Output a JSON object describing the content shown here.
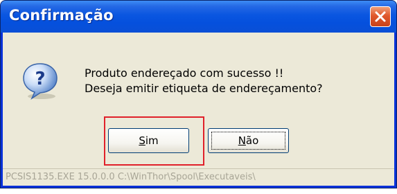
{
  "window": {
    "title": "Confirmação",
    "close_icon": "close-icon",
    "title_color": "#0a56e0"
  },
  "dialog": {
    "icon": "question-icon",
    "message_line1": "Produto endereçado com sucesso !!",
    "message_line2": "Deseja emitir etiqueta de endereçamento?",
    "buttons": {
      "yes": {
        "mnemonic": "S",
        "rest": "im"
      },
      "no": {
        "mnemonic": "N",
        "rest": "ão"
      }
    },
    "highlight_color": "#e0202a"
  },
  "statusbar": {
    "text": "PCSIS1135.EXE 15.0.0.0 C:\\WinThor\\Spool\\Executaveis\\"
  }
}
